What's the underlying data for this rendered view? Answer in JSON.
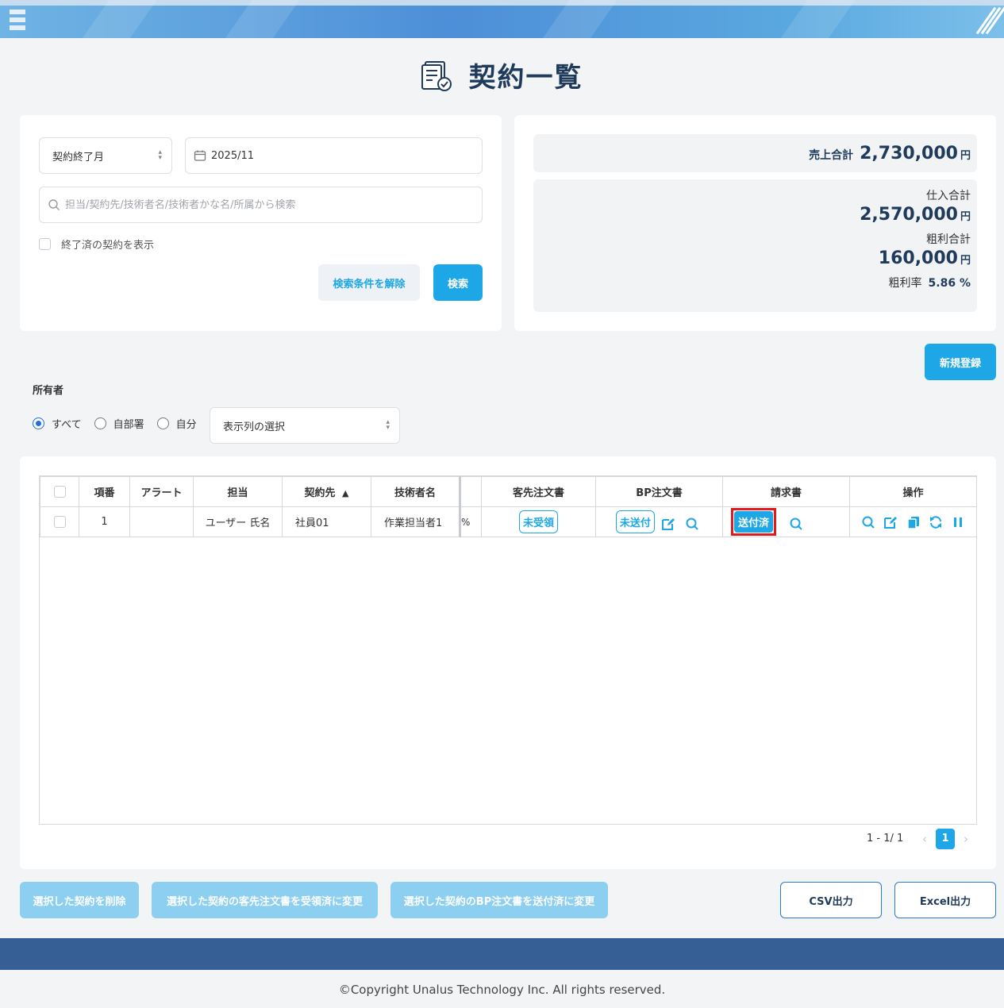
{
  "page": {
    "title": "契約一覧"
  },
  "search": {
    "month_type": "契約終了月",
    "month_value": "2025/11",
    "keyword_placeholder": "担当/契約先/技術者名/技術者かな名/所属から検索",
    "show_finished_label": "終了済の契約を表示",
    "clear_label": "検索条件を解除",
    "search_label": "検索"
  },
  "summary": {
    "sales_label": "売上合計",
    "sales_value": "2,730,000",
    "purchase_label": "仕入合計",
    "purchase_value": "2,570,000",
    "profit_label": "粗利合計",
    "profit_value": "160,000",
    "yen": "円",
    "margin_label": "粗利率",
    "margin_value": "5.86 %"
  },
  "new_label": "新規登録",
  "owner": {
    "label": "所有者",
    "options": [
      "すべて",
      "自部署",
      "自分"
    ],
    "selected": "すべて",
    "columns_placeholder": "表示列の選択"
  },
  "table": {
    "headers": [
      "項番",
      "アラート",
      "担当",
      "契約先",
      "技術者名",
      "客先注文書",
      "BP注文書",
      "請求書",
      "操作"
    ],
    "sort_indicator": "▲",
    "rows": [
      {
        "index": "1",
        "alert": "",
        "owner": "ユーザー 氏名",
        "client": "社員01",
        "engineer": "作業担当者1",
        "overflow": "%",
        "customer_order": "未受領",
        "bp_order": "未送付",
        "invoice": "送付済"
      }
    ]
  },
  "pagination": {
    "range": "1 - 1/ 1",
    "current": "1"
  },
  "bulk": {
    "delete_label": "選択した契約を削除",
    "customer_received_label": "選択した契約の客先注文書を受領済に変更",
    "bp_sent_label": "選択した契約のBP注文書を送付済に変更",
    "csv_label": "CSV出力",
    "excel_label": "Excel出力"
  },
  "footer": {
    "copyright": "©Copyright Unalus Technology Inc. All rights reserved."
  },
  "colors": {
    "accent": "#1ea7e6",
    "navy": "#1f3a5a",
    "footer": "#365f96",
    "highlight": "#e0191f"
  }
}
